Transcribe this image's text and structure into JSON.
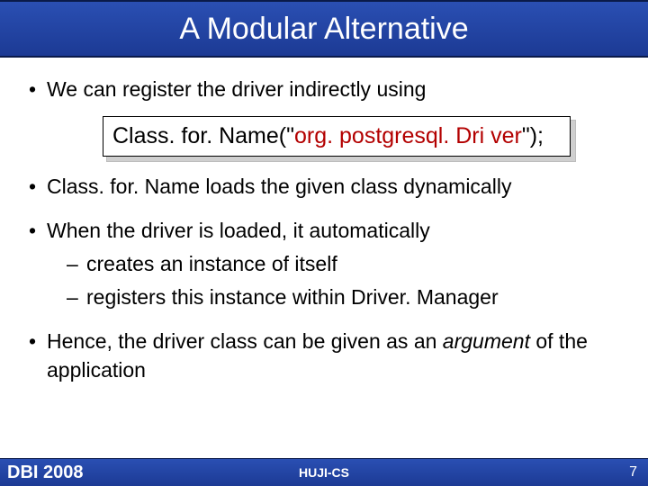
{
  "title": "A Modular Alternative",
  "bullets": {
    "b1": "We can register the driver indirectly using",
    "code_pre": "Class. for. Name(\"",
    "code_red": "org. postgresql. Dri ver",
    "code_post": "\");",
    "b2": "Class. for. Name loads the given class dynamically",
    "b3": "When the driver is loaded, it automatically",
    "s1": "creates an instance of itself",
    "s2": "registers this instance within Driver. Manager",
    "b4_pre": "Hence, the driver class can be given as an ",
    "b4_em": "argument",
    "b4_post": " of the application"
  },
  "footer": {
    "left": "DBI 2008",
    "center": "HUJI-CS",
    "page": "7"
  }
}
